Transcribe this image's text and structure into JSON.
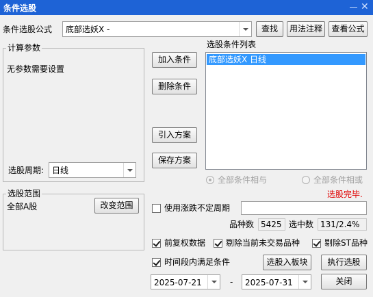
{
  "window": {
    "title": "条件选股"
  },
  "formula": {
    "label": "条件选股公式",
    "selected": "底部选妖X  -",
    "find_label": "查找",
    "usage_label": "用法注释",
    "view_label": "查看公式"
  },
  "params": {
    "group_title": "计算参数",
    "message": "无参数需要设置",
    "period_label": "选股周期:",
    "period_value": "日线"
  },
  "buttons": {
    "add": "加入条件",
    "delete": "删除条件",
    "import": "引入方案",
    "save": "保存方案"
  },
  "conditions": {
    "title": "选股条件列表",
    "items": [
      "底部选妖X  日线"
    ]
  },
  "logic": {
    "all_and": "全部条件相与",
    "all_or": "全部条件相或",
    "selected": "all_and"
  },
  "status": {
    "message": "选股完毕.",
    "color": "#e00000"
  },
  "range": {
    "group_title": "选股范围",
    "value": "全部A股",
    "change_label": "改变范围"
  },
  "options": {
    "variable_period": {
      "label": "使用涨跌不定周期",
      "checked": false,
      "value": ""
    },
    "forward_adjust": {
      "label": "前复权数据",
      "checked": true
    },
    "exclude_untraded": {
      "label": "剔除当前未交易品种",
      "checked": true
    },
    "exclude_st": {
      "label": "剔除ST品种",
      "checked": true
    },
    "time_range": {
      "label": "时间段内满足条件",
      "checked": true
    }
  },
  "stats": {
    "count_label": "品种数",
    "count_value": "5425",
    "selected_label": "选中数",
    "selected_value": "131/2.4%"
  },
  "actions": {
    "to_block": "选股入板块",
    "execute": "执行选股",
    "close": "关闭"
  },
  "dates": {
    "start": "2025-07-21",
    "separator": "-",
    "end": "2025-07-31"
  },
  "colors": {
    "titlebar": "#1e63d6",
    "selection": "#3399ff"
  }
}
